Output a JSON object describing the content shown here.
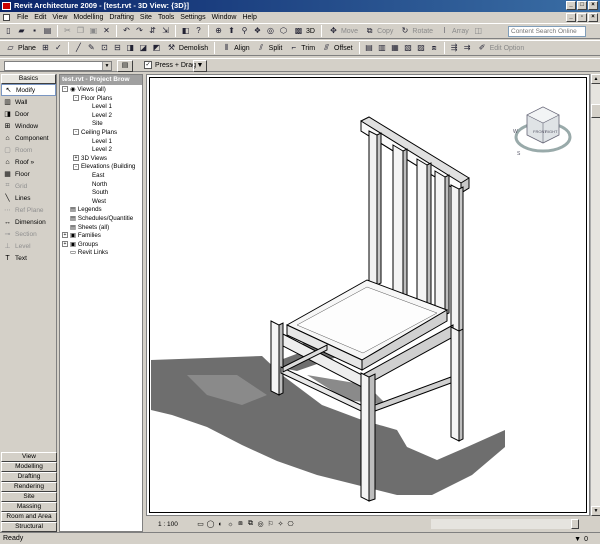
{
  "window": {
    "title": "Revit Architecture 2009 - [test.rvt - 3D View: {3D}]"
  },
  "menu": {
    "items": [
      "File",
      "Edit",
      "View",
      "Modelling",
      "Drafting",
      "Site",
      "Tools",
      "Settings",
      "Window",
      "Help"
    ]
  },
  "toolbar1": {
    "view_3d_label": "3D",
    "move_label": "Move",
    "copy_label": "Copy",
    "rotate_label": "Rotate",
    "array_label": "Array",
    "search_placeholder": "Content Search Online"
  },
  "toolbar2": {
    "plane_label": "Plane",
    "demolish_label": "Demolish",
    "align_label": "Align",
    "split_label": "Split",
    "trim_label": "Trim",
    "offset_label": "Offset",
    "edit_option_label": "Edit Option"
  },
  "options_bar": {
    "press_drag_label": "Press + Drag",
    "press_drag_checked": true
  },
  "design_bar": {
    "tabs_top": [
      "Basics"
    ],
    "items": [
      {
        "label": "Modify",
        "icon": "arrow-icon",
        "enabled": true,
        "selected": true
      },
      {
        "label": "Wall",
        "icon": "wall-icon",
        "enabled": true
      },
      {
        "label": "Door",
        "icon": "door-icon",
        "enabled": true
      },
      {
        "label": "Window",
        "icon": "window-icon",
        "enabled": true
      },
      {
        "label": "Component",
        "icon": "component-icon",
        "enabled": true
      },
      {
        "label": "Room",
        "icon": "room-icon",
        "enabled": false
      },
      {
        "label": "Roof »",
        "icon": "roof-icon",
        "enabled": true
      },
      {
        "label": "Floor",
        "icon": "floor-icon",
        "enabled": true
      },
      {
        "label": "Grid",
        "icon": "grid-icon",
        "enabled": false
      },
      {
        "label": "Lines",
        "icon": "lines-icon",
        "enabled": true
      },
      {
        "label": "Ref Plane",
        "icon": "ref-plane-icon",
        "enabled": false
      },
      {
        "label": "Dimension",
        "icon": "dimension-icon",
        "enabled": true
      },
      {
        "label": "Section",
        "icon": "section-icon",
        "enabled": false
      },
      {
        "label": "Level",
        "icon": "level-icon",
        "enabled": false
      },
      {
        "label": "Text",
        "icon": "text-icon",
        "enabled": true
      }
    ],
    "tabs_bottom": [
      "View",
      "Modelling",
      "Drafting",
      "Rendering",
      "Site",
      "Massing",
      "Room and Area",
      "Structural"
    ]
  },
  "project_browser": {
    "title": "test.rvt - Project Brow",
    "tree": [
      {
        "label": "Views (all)",
        "level": 0,
        "expander": "-",
        "icon": "eye"
      },
      {
        "label": "Floor Plans",
        "level": 1,
        "expander": "-"
      },
      {
        "label": "Level 1",
        "level": 2
      },
      {
        "label": "Level 2",
        "level": 2
      },
      {
        "label": "Site",
        "level": 2
      },
      {
        "label": "Ceiling Plans",
        "level": 1,
        "expander": "-"
      },
      {
        "label": "Level 1",
        "level": 2
      },
      {
        "label": "Level 2",
        "level": 2
      },
      {
        "label": "3D Views",
        "level": 1,
        "expander": "+"
      },
      {
        "label": "Elevations (Building",
        "level": 1,
        "expander": "-"
      },
      {
        "label": "East",
        "level": 2
      },
      {
        "label": "North",
        "level": 2
      },
      {
        "label": "South",
        "level": 2
      },
      {
        "label": "West",
        "level": 2
      },
      {
        "label": "Legends",
        "level": 0,
        "icon": "sheet"
      },
      {
        "label": "Schedules/Quantitie",
        "level": 0,
        "icon": "sheet"
      },
      {
        "label": "Sheets (all)",
        "level": 0,
        "icon": "sheet"
      },
      {
        "label": "Families",
        "level": 0,
        "expander": "+",
        "icon": "folder"
      },
      {
        "label": "Groups",
        "level": 0,
        "expander": "+",
        "icon": "folder"
      },
      {
        "label": "Revit Links",
        "level": 0,
        "icon": "link"
      }
    ]
  },
  "viewcube": {
    "faces": [
      "FRONT",
      "RIGHT"
    ],
    "compass": [
      "W",
      "S"
    ]
  },
  "view_control": {
    "scale": "1 : 100"
  },
  "status": {
    "text": "Ready",
    "filter_count": "0"
  }
}
